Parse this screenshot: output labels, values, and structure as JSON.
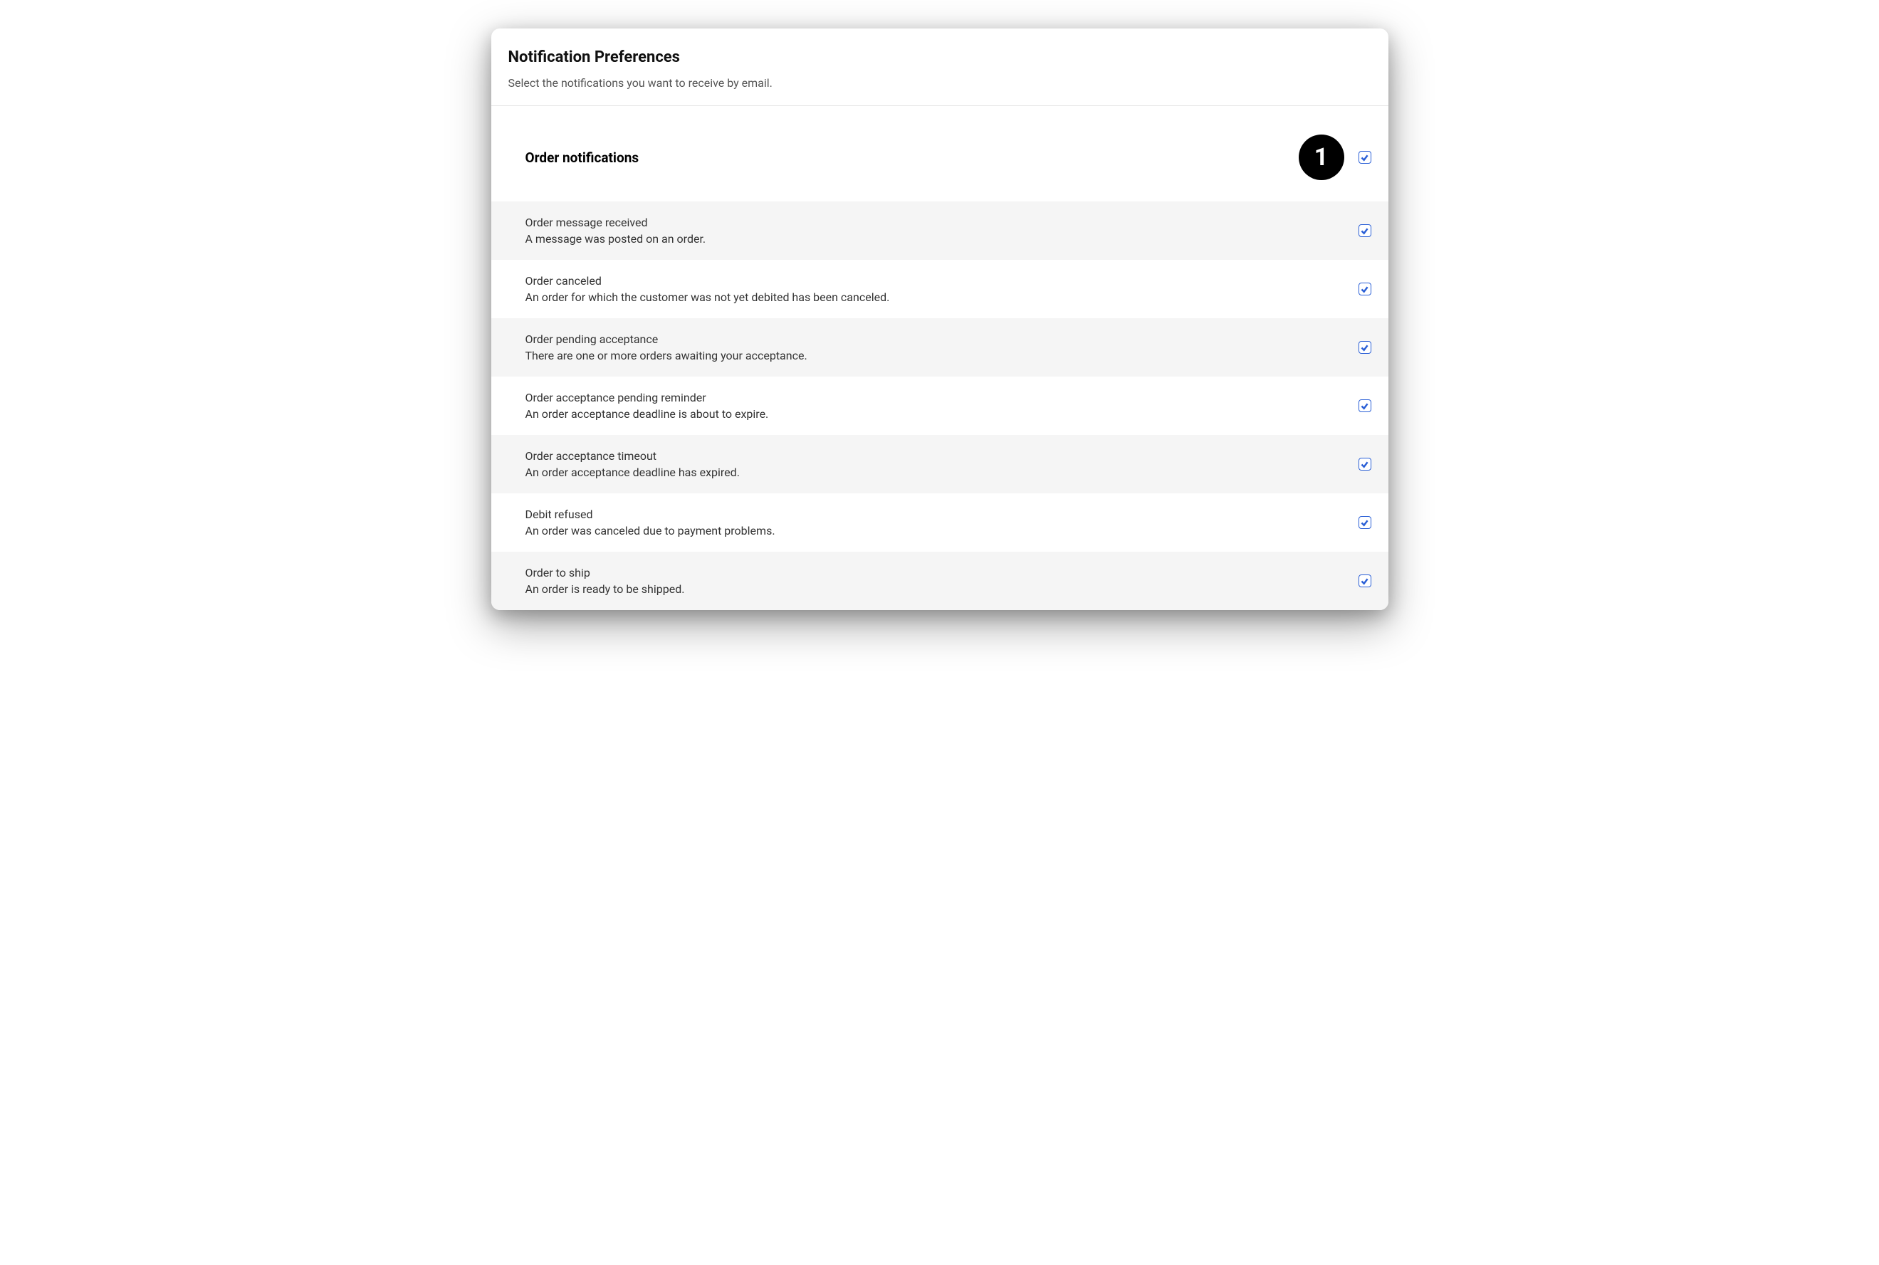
{
  "header": {
    "title": "Notification Preferences",
    "subtitle": "Select the notifications you want to receive by email."
  },
  "section": {
    "title": "Order notifications",
    "badge": "1",
    "master_checked": true
  },
  "rows": [
    {
      "title": "Order message received",
      "desc": "A message was posted on an order.",
      "checked": true
    },
    {
      "title": "Order canceled",
      "desc": "An order for which the customer was not yet debited has been canceled.",
      "checked": true
    },
    {
      "title": "Order pending acceptance",
      "desc": "There are one or more orders awaiting your acceptance.",
      "checked": true
    },
    {
      "title": "Order acceptance pending reminder",
      "desc": "An order acceptance deadline is about to expire.",
      "checked": true
    },
    {
      "title": "Order acceptance timeout",
      "desc": "An order acceptance deadline has expired.",
      "checked": true
    },
    {
      "title": "Debit refused",
      "desc": "An order was canceled due to payment problems.",
      "checked": true
    },
    {
      "title": "Order to ship",
      "desc": "An order is ready to be shipped.",
      "checked": true
    }
  ]
}
